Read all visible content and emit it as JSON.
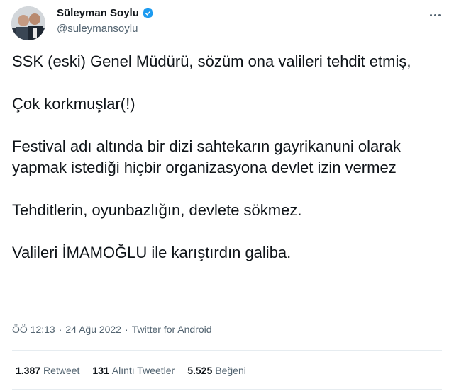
{
  "author": {
    "name": "Süleyman Soylu",
    "handle": "@suleymansoylu",
    "verified_color": "#1d9bf0"
  },
  "tweet": {
    "lines": [
      "SSK (eski) Genel Müdürü, sözüm ona valileri tehdit etmiş,",
      "Çok korkmuşlar(!)",
      "Festival adı altında bir dizi sahtekarın gayrikanuni olarak yapmak istediği hiçbir organizasyona devlet izin vermez",
      "Tehditlerin, oyunbazlığın, devlete sökmez.",
      "Valileri İMAMOĞLU ile karıştırdın galiba."
    ],
    "time": "ÖÖ 12:13",
    "dot": "·",
    "date": "24 Ağu 2022",
    "source": "Twitter for Android"
  },
  "stats": {
    "retweets_count": "1.387",
    "retweets_label": "Retweet",
    "quotes_count": "131",
    "quotes_label": "Alıntı Tweetler",
    "likes_count": "5.525",
    "likes_label": "Beğeni"
  },
  "icons": {
    "more": "more-options-icon",
    "verified": "verified-badge-icon"
  }
}
